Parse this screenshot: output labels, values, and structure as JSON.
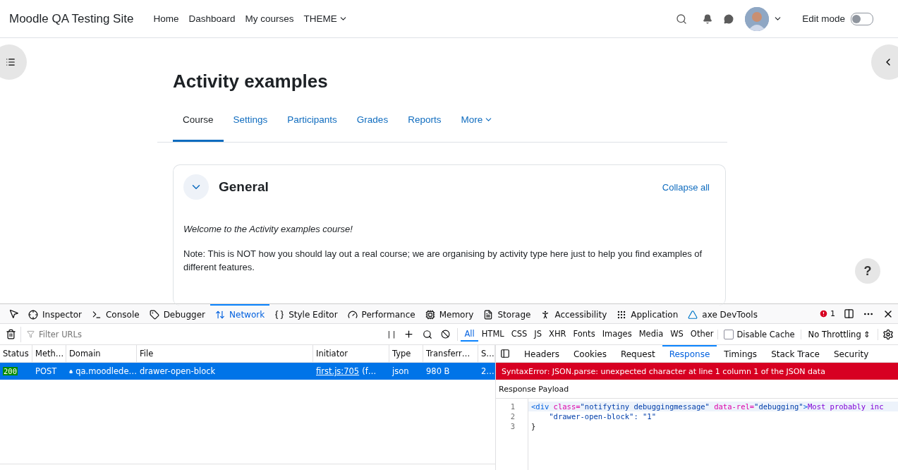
{
  "site": {
    "title": "Moodle QA Testing Site",
    "nav": [
      {
        "label": "Home",
        "dropdown": false
      },
      {
        "label": "Dashboard",
        "dropdown": false
      },
      {
        "label": "My courses",
        "dropdown": false
      },
      {
        "label": "THEME",
        "dropdown": true
      }
    ],
    "edit_mode": {
      "label": "Edit mode",
      "on": false
    }
  },
  "course": {
    "title": "Activity examples",
    "tabs": [
      {
        "label": "Course",
        "selected": true,
        "dropdown": false
      },
      {
        "label": "Settings",
        "selected": false,
        "dropdown": false
      },
      {
        "label": "Participants",
        "selected": false,
        "dropdown": false
      },
      {
        "label": "Grades",
        "selected": false,
        "dropdown": false
      },
      {
        "label": "Reports",
        "selected": false,
        "dropdown": false
      },
      {
        "label": "More",
        "selected": false,
        "dropdown": true
      }
    ],
    "section": {
      "title": "General",
      "expanded": true,
      "collapse_link": "Collapse all",
      "welcome": "Welcome to the Activity examples course!",
      "note": "Note: This is NOT how you should lay out a real course; we are organising by activity type here just to help you find examples of different features."
    },
    "help": "?"
  },
  "devtools": {
    "tabs": [
      {
        "label": "Inspector",
        "selected": false
      },
      {
        "label": "Console",
        "selected": false
      },
      {
        "label": "Debugger",
        "selected": false
      },
      {
        "label": "Network",
        "selected": true
      },
      {
        "label": "Style Editor",
        "selected": false
      },
      {
        "label": "Performance",
        "selected": false
      },
      {
        "label": "Memory",
        "selected": false
      },
      {
        "label": "Storage",
        "selected": false
      },
      {
        "label": "Accessibility",
        "selected": false
      },
      {
        "label": "Application",
        "selected": false
      },
      {
        "label": "axe DevTools",
        "selected": false
      }
    ],
    "error_count": "1",
    "filter": {
      "placeholder": "Filter URLs",
      "pause": "| |"
    },
    "type_filters": [
      {
        "label": "All",
        "selected": true
      },
      {
        "label": "HTML",
        "selected": false
      },
      {
        "label": "CSS",
        "selected": false
      },
      {
        "label": "JS",
        "selected": false
      },
      {
        "label": "XHR",
        "selected": false
      },
      {
        "label": "Fonts",
        "selected": false
      },
      {
        "label": "Images",
        "selected": false
      },
      {
        "label": "Media",
        "selected": false
      },
      {
        "label": "WS",
        "selected": false
      },
      {
        "label": "Other",
        "selected": false
      }
    ],
    "disable_cache": {
      "label": "Disable Cache",
      "checked": false
    },
    "throttling": "No Throttling ⇕",
    "columns": [
      "Status",
      "Meth…",
      "Domain",
      "File",
      "Initiator",
      "Type",
      "Transferr…",
      "S…"
    ],
    "requests": [
      {
        "status": "200",
        "method": "POST",
        "domain": "qa.moodlede…",
        "file": "drawer-open-block",
        "initiator_link": "first.js:705",
        "initiator_rest": "(f…",
        "type": "json",
        "transferred": "980 B",
        "size": "2…",
        "selected": true
      }
    ],
    "detail_tabs": [
      {
        "label": "Headers",
        "selected": false
      },
      {
        "label": "Cookies",
        "selected": false
      },
      {
        "label": "Request",
        "selected": false
      },
      {
        "label": "Response",
        "selected": true
      },
      {
        "label": "Timings",
        "selected": false
      },
      {
        "label": "Stack Trace",
        "selected": false
      },
      {
        "label": "Security",
        "selected": false
      }
    ],
    "error": "SyntaxError: JSON.parse: unexpected character at line 1 column 1 of the JSON data",
    "payload_title": "Response Payload",
    "code": [
      {
        "number": "1",
        "tokens": [
          {
            "kind": "tag",
            "text": "<div "
          },
          {
            "kind": "attr",
            "text": "class="
          },
          {
            "kind": "string",
            "text": "\"notifytiny debuggingmessage\" "
          },
          {
            "kind": "attr",
            "text": "data-rel="
          },
          {
            "kind": "string",
            "text": "\"debugging\""
          },
          {
            "kind": "tag",
            "text": ">"
          },
          {
            "kind": "content",
            "text": "Most probably inc"
          }
        ]
      },
      {
        "number": "2",
        "tokens": [
          {
            "kind": "string",
            "text": "    \"drawer-open-block\": \"1\""
          }
        ]
      },
      {
        "number": "3",
        "tokens": [
          {
            "kind": "plain",
            "text": "}"
          }
        ]
      }
    ]
  }
}
